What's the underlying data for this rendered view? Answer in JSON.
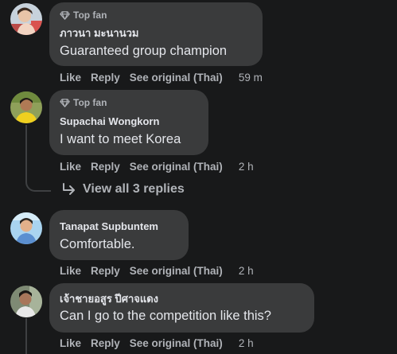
{
  "colors": {
    "background": "#18191a",
    "bubble": "#3a3b3c",
    "text_primary": "#e4e6eb",
    "text_secondary": "#b0b3b8",
    "thread_line": "#3e4042"
  },
  "comments": [
    {
      "badge": "Top fan",
      "badge_icon": "diamond-icon",
      "author": "ภาวนา มะนานวม",
      "text": "Guaranteed group champion",
      "actions": {
        "like": "Like",
        "reply": "Reply",
        "see_original": "See original (Thai)"
      },
      "time": "59 m"
    },
    {
      "badge": "Top fan",
      "badge_icon": "diamond-icon",
      "author": "Supachai Wongkorn",
      "text": "I want to meet Korea",
      "actions": {
        "like": "Like",
        "reply": "Reply",
        "see_original": "See original (Thai)"
      },
      "time": "2 h",
      "view_replies": "View all 3 replies"
    },
    {
      "author": "Tanapat Supbuntem",
      "text": "Comfortable.",
      "actions": {
        "like": "Like",
        "reply": "Reply",
        "see_original": "See original (Thai)"
      },
      "time": "2 h"
    },
    {
      "author": "เจ้าชายอสูร ปีศาจแดง",
      "text": "Can I go to the competition like this?",
      "actions": {
        "like": "Like",
        "reply": "Reply",
        "see_original": "See original (Thai)"
      },
      "time": "2 h"
    }
  ]
}
